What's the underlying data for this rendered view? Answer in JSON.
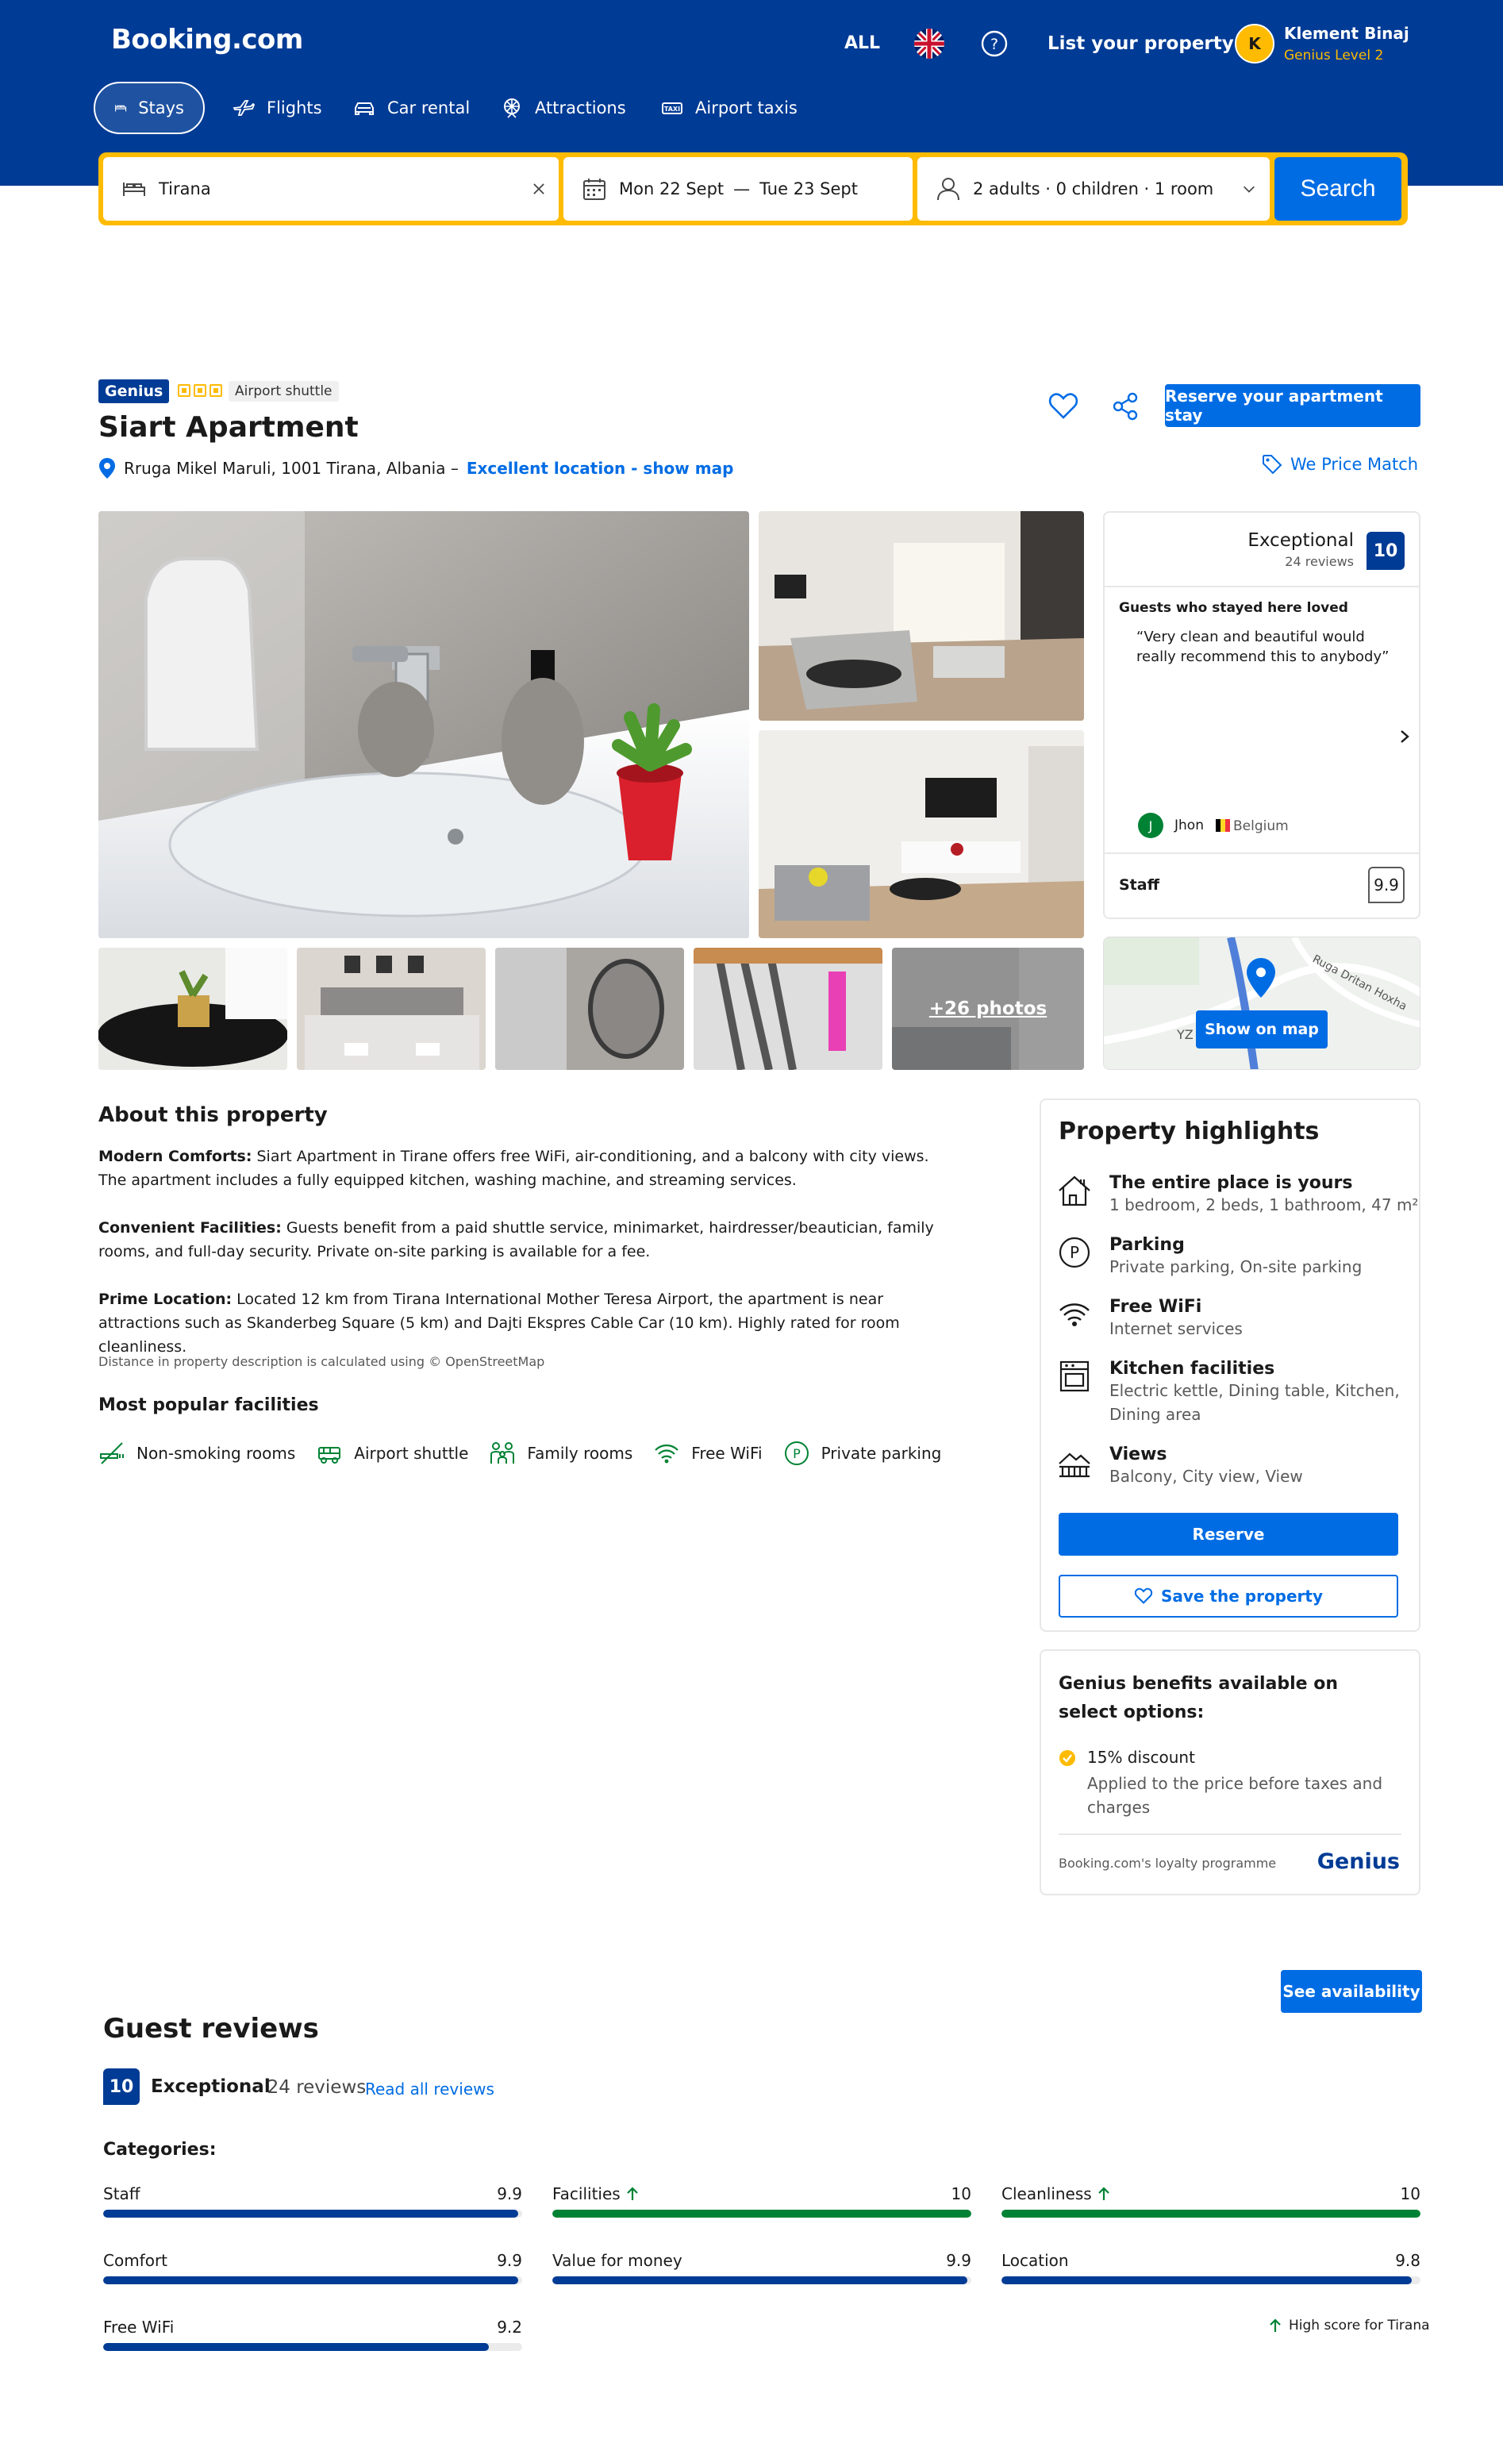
{
  "brand": {
    "name": "Booking.com"
  },
  "header": {
    "lang_label": "ALL",
    "flag": "uk-flag-icon",
    "help_icon": "help-icon",
    "list_property": "List your property",
    "user": {
      "initial": "K",
      "name": "Klement Binaj",
      "level": "Genius Level 2"
    }
  },
  "nav": {
    "tabs": [
      {
        "label": "Stays",
        "icon": "bed-icon",
        "active": true
      },
      {
        "label": "Flights",
        "icon": "plane-icon",
        "active": false
      },
      {
        "label": "Car rental",
        "icon": "car-icon",
        "active": false
      },
      {
        "label": "Attractions",
        "icon": "attractions-icon",
        "active": false
      },
      {
        "label": "Airport taxis",
        "icon": "taxi-icon",
        "active": false
      }
    ]
  },
  "search": {
    "destination": "Tirana",
    "check_in": "Mon 22 Sept",
    "dash": "—",
    "check_out": "Tue 23 Sept",
    "guests": "2 adults · 0 children · 1 room",
    "button": "Search"
  },
  "property": {
    "genius_badge": "Genius",
    "stars": 3,
    "chip": "Airport shuttle",
    "title": "Siart Apartment",
    "address": "Rruga Mikel Maruli, 1001 Tirana, Albania –",
    "location_link": "Excellent location - show map",
    "reserve_button": "Reserve your apartment stay",
    "price_match": "We Price Match"
  },
  "photos": {
    "more_label": "+26 photos"
  },
  "review_card": {
    "rating_word": "Exceptional",
    "reviews_count": "24 reviews",
    "score": "10",
    "loved_heading": "Guests who stayed here loved",
    "quote": "“Very clean and beautiful would really recommend this to anybody”",
    "reviewer_initial": "J",
    "reviewer_name": "Jhon",
    "reviewer_country": "Belgium",
    "staff_label": "Staff",
    "staff_score": "9.9"
  },
  "map": {
    "button": "Show on map",
    "street": "Ruga Dritan Hoxha",
    "label": "YZ"
  },
  "about": {
    "heading": "About this property",
    "p1_title": "Modern Comforts:",
    "p1_text": " Siart Apartment in Tirane offers free WiFi, air-conditioning, and a balcony with city views. The apartment includes a fully equipped kitchen, washing machine, and streaming services.",
    "p2_title": "Convenient Facilities:",
    "p2_text": " Guests benefit from a paid shuttle service, minimarket, hairdresser/beautician, family rooms, and full-day security. Private on-site parking is available for a fee.",
    "p3_title": "Prime Location:",
    "p3_text": " Located 12 km from Tirana International Mother Teresa Airport, the apartment is near attractions such as Skanderbeg Square (5 km) and Dajti Ekspres Cable Car (10 km). Highly rated for room cleanliness.",
    "note": "Distance in property description is calculated using © OpenStreetMap"
  },
  "facilities": {
    "heading": "Most popular facilities",
    "items": [
      {
        "label": "Non-smoking rooms",
        "icon": "no-smoking-icon"
      },
      {
        "label": "Airport shuttle",
        "icon": "shuttle-icon"
      },
      {
        "label": "Family rooms",
        "icon": "family-icon"
      },
      {
        "label": "Free WiFi",
        "icon": "wifi-icon"
      },
      {
        "label": "Private parking",
        "icon": "parking-icon"
      }
    ]
  },
  "highlights": {
    "heading": "Property highlights",
    "items": [
      {
        "title": "The entire place is yours",
        "sub": "1 bedroom, 2 beds, 1 bathroom, 47 m²",
        "icon": "house-icon"
      },
      {
        "title": "Parking",
        "sub": "Private parking, On-site parking",
        "icon": "parking-icon"
      },
      {
        "title": "Free WiFi",
        "sub": "Internet services",
        "icon": "wifi-icon"
      },
      {
        "title": "Kitchen facilities",
        "sub": "Electric kettle, Dining table, Kitchen, Dining area",
        "icon": "kitchen-icon"
      },
      {
        "title": "Views",
        "sub": "Balcony, City view, View",
        "icon": "views-icon"
      }
    ],
    "reserve": "Reserve",
    "save": "Save the property"
  },
  "genius": {
    "heading": "Genius benefits available on select options:",
    "benefit_title": "15% discount",
    "benefit_sub": "Applied to the price before taxes and charges",
    "footer": "Booking.com's loyalty programme",
    "logo": "Genius"
  },
  "availability_button": "See availability",
  "reviews": {
    "heading": "Guest reviews",
    "score": "10",
    "rating_word": "Exceptional",
    "count": "· 24 reviews",
    "read_all": "Read all reviews",
    "categories_label": "Categories:",
    "categories": [
      {
        "name": "Staff",
        "score": "9.9",
        "value": 9.9,
        "high": false
      },
      {
        "name": "Facilities",
        "score": "10",
        "value": 10,
        "high": true
      },
      {
        "name": "Cleanliness",
        "score": "10",
        "value": 10,
        "high": true
      },
      {
        "name": "Comfort",
        "score": "9.9",
        "value": 9.9,
        "high": false
      },
      {
        "name": "Value for money",
        "score": "9.9",
        "value": 9.9,
        "high": false
      },
      {
        "name": "Location",
        "score": "9.8",
        "value": 9.8,
        "high": false
      },
      {
        "name": "Free WiFi",
        "score": "9.2",
        "value": 9.2,
        "high": false
      }
    ],
    "high_score_note": "High score for Tirana"
  },
  "colors": {
    "brand_blue": "#003b95",
    "action_blue": "#006ce4",
    "yellow": "#febb02",
    "green": "#008234"
  }
}
